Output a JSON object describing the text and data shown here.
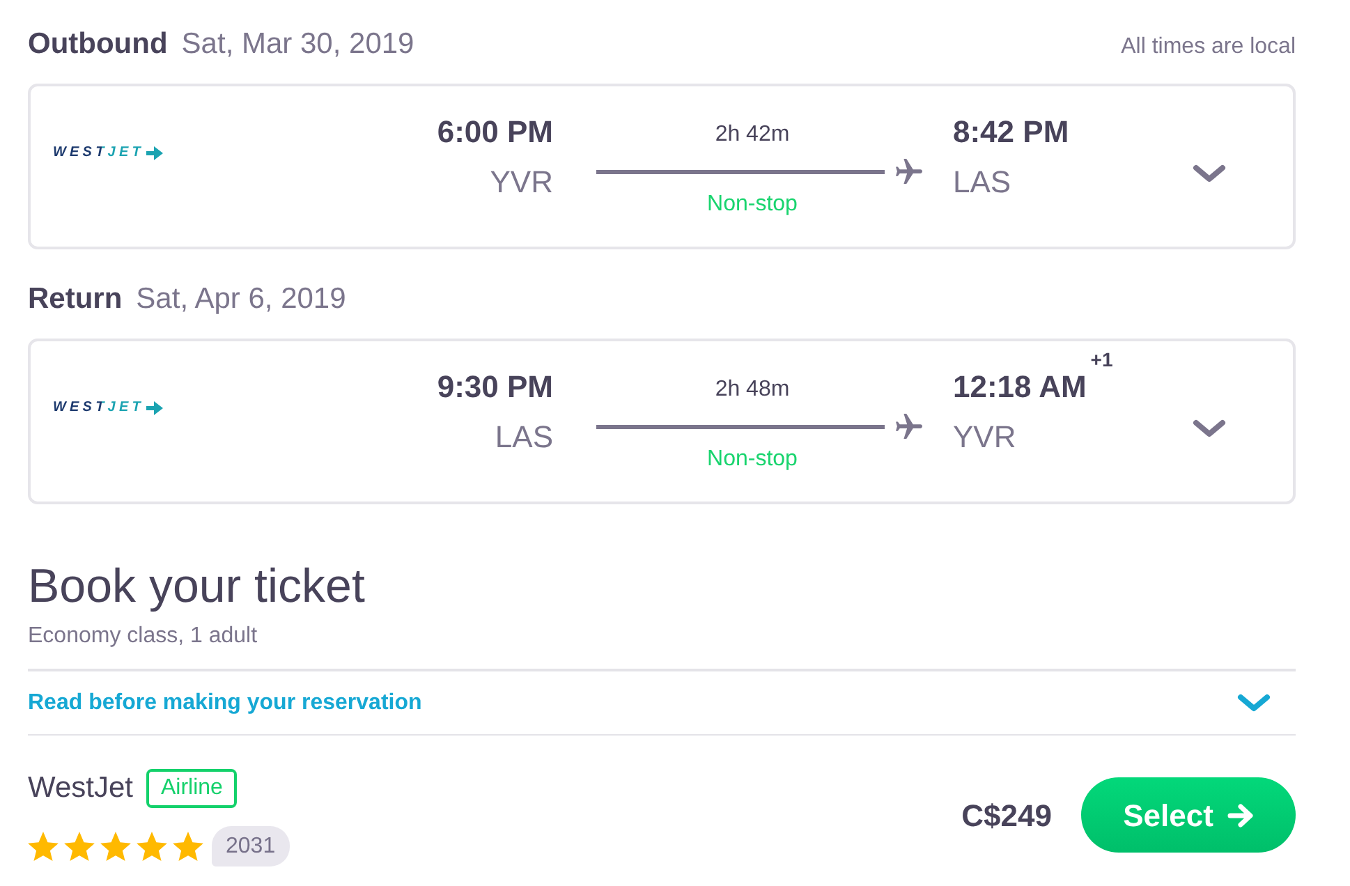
{
  "times_note": "All times are local",
  "legs": [
    {
      "label": "Outbound",
      "date": "Sat, Mar 30, 2019",
      "logo_text": "WESTJET",
      "departure": {
        "time": "6:00 PM",
        "airport": "YVR"
      },
      "duration": "2h 42m",
      "stops": "Non-stop",
      "arrival": {
        "time": "8:42 PM",
        "airport": "LAS"
      },
      "expanded": false
    },
    {
      "label": "Return",
      "date": "Sat, Apr 6, 2019",
      "logo_text": "WESTJET",
      "departure": {
        "time": "9:30 PM",
        "airport": "LAS"
      },
      "duration": "2h 48m",
      "stops": "Non-stop",
      "arrival": {
        "time": "12:18 AM",
        "day_offset": "+1",
        "airport": "YVR"
      },
      "expanded": false
    }
  ],
  "booking": {
    "title": "Book your ticket",
    "subtitle": "Economy class, 1 adult",
    "notice": {
      "label": "Read before making your reservation",
      "expanded": false
    },
    "offer": {
      "provider": "WestJet",
      "provider_type": "Airline",
      "stars": 5,
      "review_count": "2031",
      "price": "C$249",
      "button": "Select"
    }
  }
}
